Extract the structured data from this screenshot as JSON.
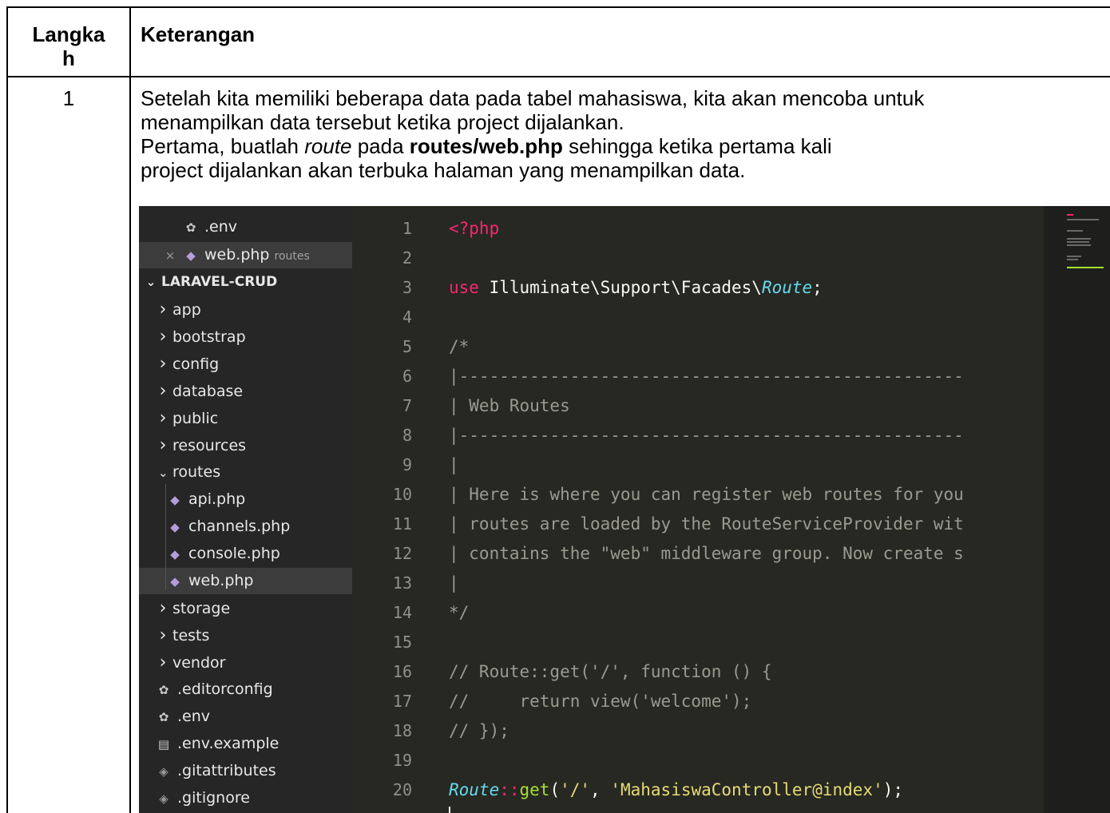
{
  "table": {
    "header_step": "Langka h",
    "header_step_line1": "Langka",
    "header_step_line2": "h",
    "header_desc": "Keterangan",
    "step_number": "1",
    "para1_line1": "Setelah kita memiliki beberapa data pada tabel mahasiswa, kita akan mencoba untuk",
    "para1_line2": "menampilkan data tersebut ketika project dijalankan.",
    "para2_pre": "Pertama, buatlah ",
    "para2_em": "route",
    "para2_mid": " pada ",
    "para2_bold": "routes/web.php",
    "para2_post": " sehingga ketika pertama kali",
    "para2_line2": "project dijalankan akan terbuka halaman yang menampilkan data."
  },
  "editor": {
    "open_files": [
      {
        "name": ".env",
        "icon": "gear-icon"
      },
      {
        "name": "web.php",
        "folder": "routes",
        "icon": "php-icon",
        "close": "×"
      }
    ],
    "project": "LARAVEL-CRUD",
    "tree": [
      {
        "label": "app",
        "type": "folder"
      },
      {
        "label": "bootstrap",
        "type": "folder"
      },
      {
        "label": "config",
        "type": "folder"
      },
      {
        "label": "database",
        "type": "folder"
      },
      {
        "label": "public",
        "type": "folder"
      },
      {
        "label": "resources",
        "type": "folder"
      },
      {
        "label": "routes",
        "type": "folder-open"
      },
      {
        "label": "api.php",
        "type": "php"
      },
      {
        "label": "channels.php",
        "type": "php"
      },
      {
        "label": "console.php",
        "type": "php"
      },
      {
        "label": "web.php",
        "type": "php",
        "selected": true
      },
      {
        "label": "storage",
        "type": "folder"
      },
      {
        "label": "tests",
        "type": "folder"
      },
      {
        "label": "vendor",
        "type": "folder"
      },
      {
        "label": ".editorconfig",
        "type": "gear"
      },
      {
        "label": ".env",
        "type": "gear"
      },
      {
        "label": ".env.example",
        "type": "file"
      },
      {
        "label": ".gitattributes",
        "type": "git"
      },
      {
        "label": ".gitignore",
        "type": "git"
      }
    ],
    "line_numbers": [
      "1",
      "2",
      "3",
      "4",
      "5",
      "6",
      "7",
      "8",
      "9",
      "10",
      "11",
      "12",
      "13",
      "14",
      "15",
      "16",
      "17",
      "18",
      "19",
      "20"
    ],
    "code": {
      "l1": "<?php",
      "l3_kw": "use",
      "l3_ns": " Illuminate\\Support\\Facades\\",
      "l3_cls": "Route",
      "l3_end": ";",
      "l5": "/*",
      "l6": "|--------------------------------------------------",
      "l7": "| Web Routes",
      "l8": "|--------------------------------------------------",
      "l9": "|",
      "l10": "| Here is where you can register web routes for you",
      "l11": "| routes are loaded by the RouteServiceProvider wit",
      "l12": "| contains the \"web\" middleware group. Now create s",
      "l13": "|",
      "l14": "*/",
      "l16": "// Route::get('/', function () {",
      "l17": "//     return view('welcome');",
      "l18": "// });",
      "l20_cls": "Route",
      "l20_op": "::",
      "l20_fn": "get",
      "l20_p1": "(",
      "l20_s1": "'/'",
      "l20_comma": ", ",
      "l20_s2": "'MahasiswaController@index'",
      "l20_end": ");"
    }
  }
}
